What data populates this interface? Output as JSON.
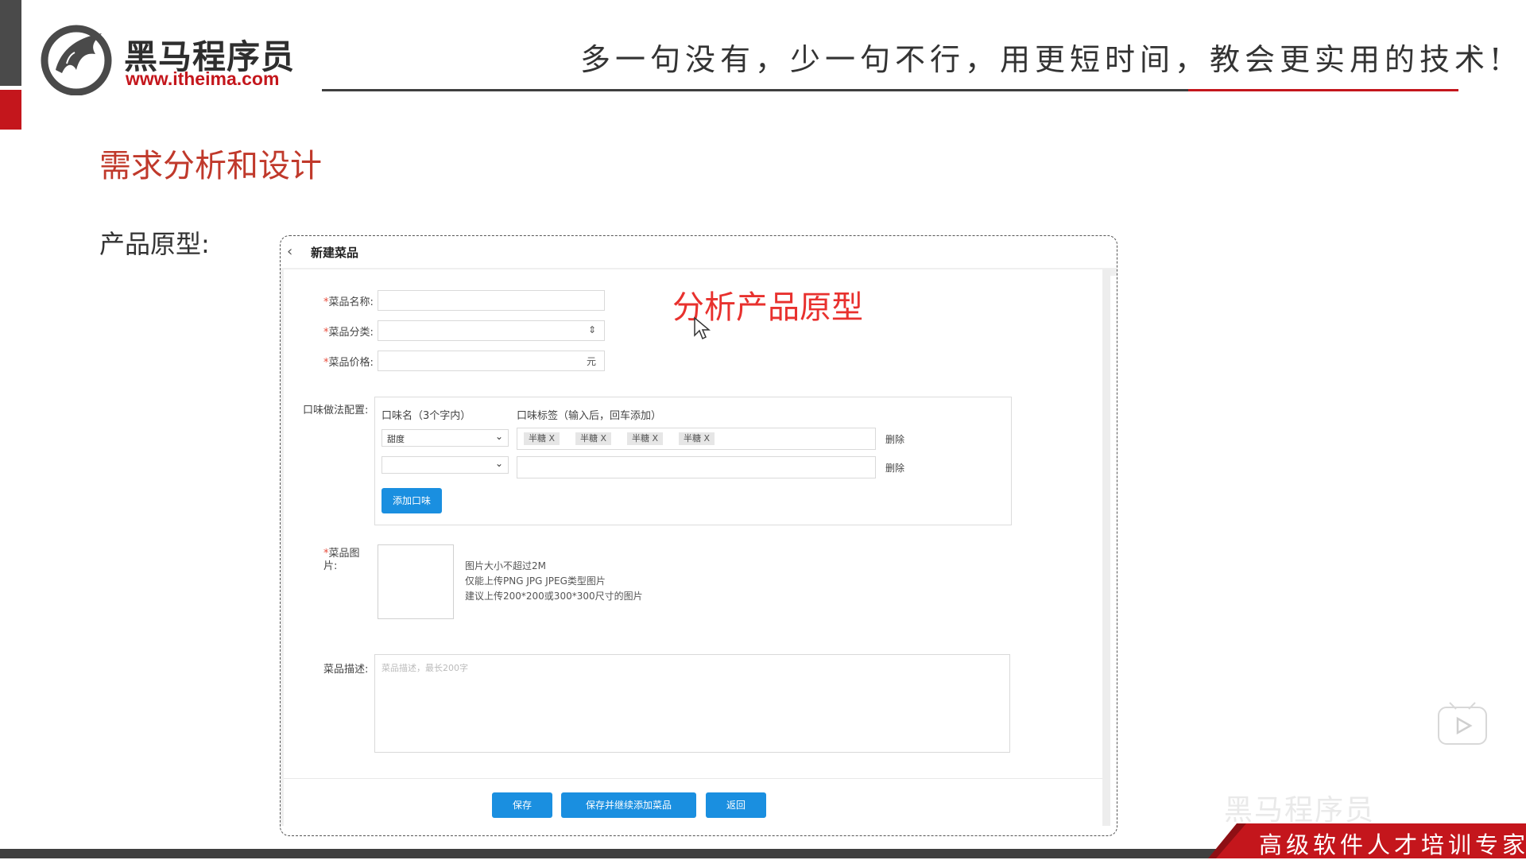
{
  "brand": {
    "name_cn": "黑马程序员",
    "url": "www.itheima.com",
    "slogan": "多一句没有，少一句不行，用更短时间，教会更实用的技术!",
    "footer_tag": "高级软件人才培训专家",
    "watermark": "黑马程序员"
  },
  "colors": {
    "brand_red": "#c4161c",
    "accent_blue": "#1a8fe0",
    "annotation_red": "#e8312e"
  },
  "page": {
    "title": "需求分析和设计",
    "section_label": "产品原型:",
    "annotation": "分析产品原型"
  },
  "prototype": {
    "back_icon": "‹",
    "title": "新建菜品",
    "fields": {
      "name_label": "菜品名称:",
      "category_label": "菜品分类:",
      "category_icon": "⇕",
      "price_label": "菜品价格:",
      "price_unit": "元"
    },
    "flavor": {
      "label": "口味做法配置:",
      "col_name": "口味名（3个字内）",
      "col_tags": "口味标签（输入后，回车添加）",
      "rows": [
        {
          "name": "甜度",
          "tags": [
            "半糖",
            "半糖",
            "半糖",
            "半糖"
          ],
          "delete": "删除"
        },
        {
          "name": "",
          "tags": [],
          "delete": "删除"
        }
      ],
      "tag_close": "X",
      "add_button": "添加口味"
    },
    "image": {
      "label_line1": "菜品图",
      "label_line2": "片:",
      "hints": [
        "图片大小不超过2M",
        "仅能上传PNG JPG JPEG类型图片",
        "建议上传200*200或300*300尺寸的图片"
      ]
    },
    "description": {
      "label": "菜品描述:",
      "placeholder": "菜品描述，最长200字"
    },
    "actions": {
      "save": "保存",
      "save_continue": "保存并继续添加菜品",
      "back": "返回"
    }
  }
}
